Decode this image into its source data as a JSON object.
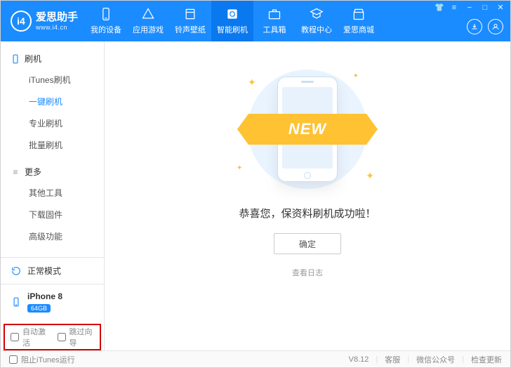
{
  "brand": {
    "badge": "i4",
    "name": "爱思助手",
    "site": "www.i4.cn"
  },
  "tabs": [
    {
      "label": "我的设备"
    },
    {
      "label": "应用游戏"
    },
    {
      "label": "铃声壁纸"
    },
    {
      "label": "智能刷机"
    },
    {
      "label": "工具箱"
    },
    {
      "label": "教程中心"
    },
    {
      "label": "爱思商城"
    }
  ],
  "sidebar": {
    "groups": [
      {
        "title": "刷机",
        "items": [
          "iTunes刷机",
          "一键刷机",
          "专业刷机",
          "批量刷机"
        ]
      },
      {
        "title": "更多",
        "items": [
          "其他工具",
          "下载固件",
          "高级功能"
        ]
      }
    ],
    "mode": "正常模式",
    "device": {
      "name": "iPhone 8",
      "storage": "64GB"
    },
    "checkboxes": {
      "auto_activate": "自动激活",
      "skip_guide": "跳过向导"
    }
  },
  "main": {
    "ribbon": "NEW",
    "success": "恭喜您，保资料刷机成功啦！",
    "ok": "确定",
    "log": "查看日志"
  },
  "footer": {
    "block_itunes": "阻止iTunes运行",
    "version": "V8.12",
    "support": "客服",
    "wechat": "微信公众号",
    "update": "检查更新"
  }
}
